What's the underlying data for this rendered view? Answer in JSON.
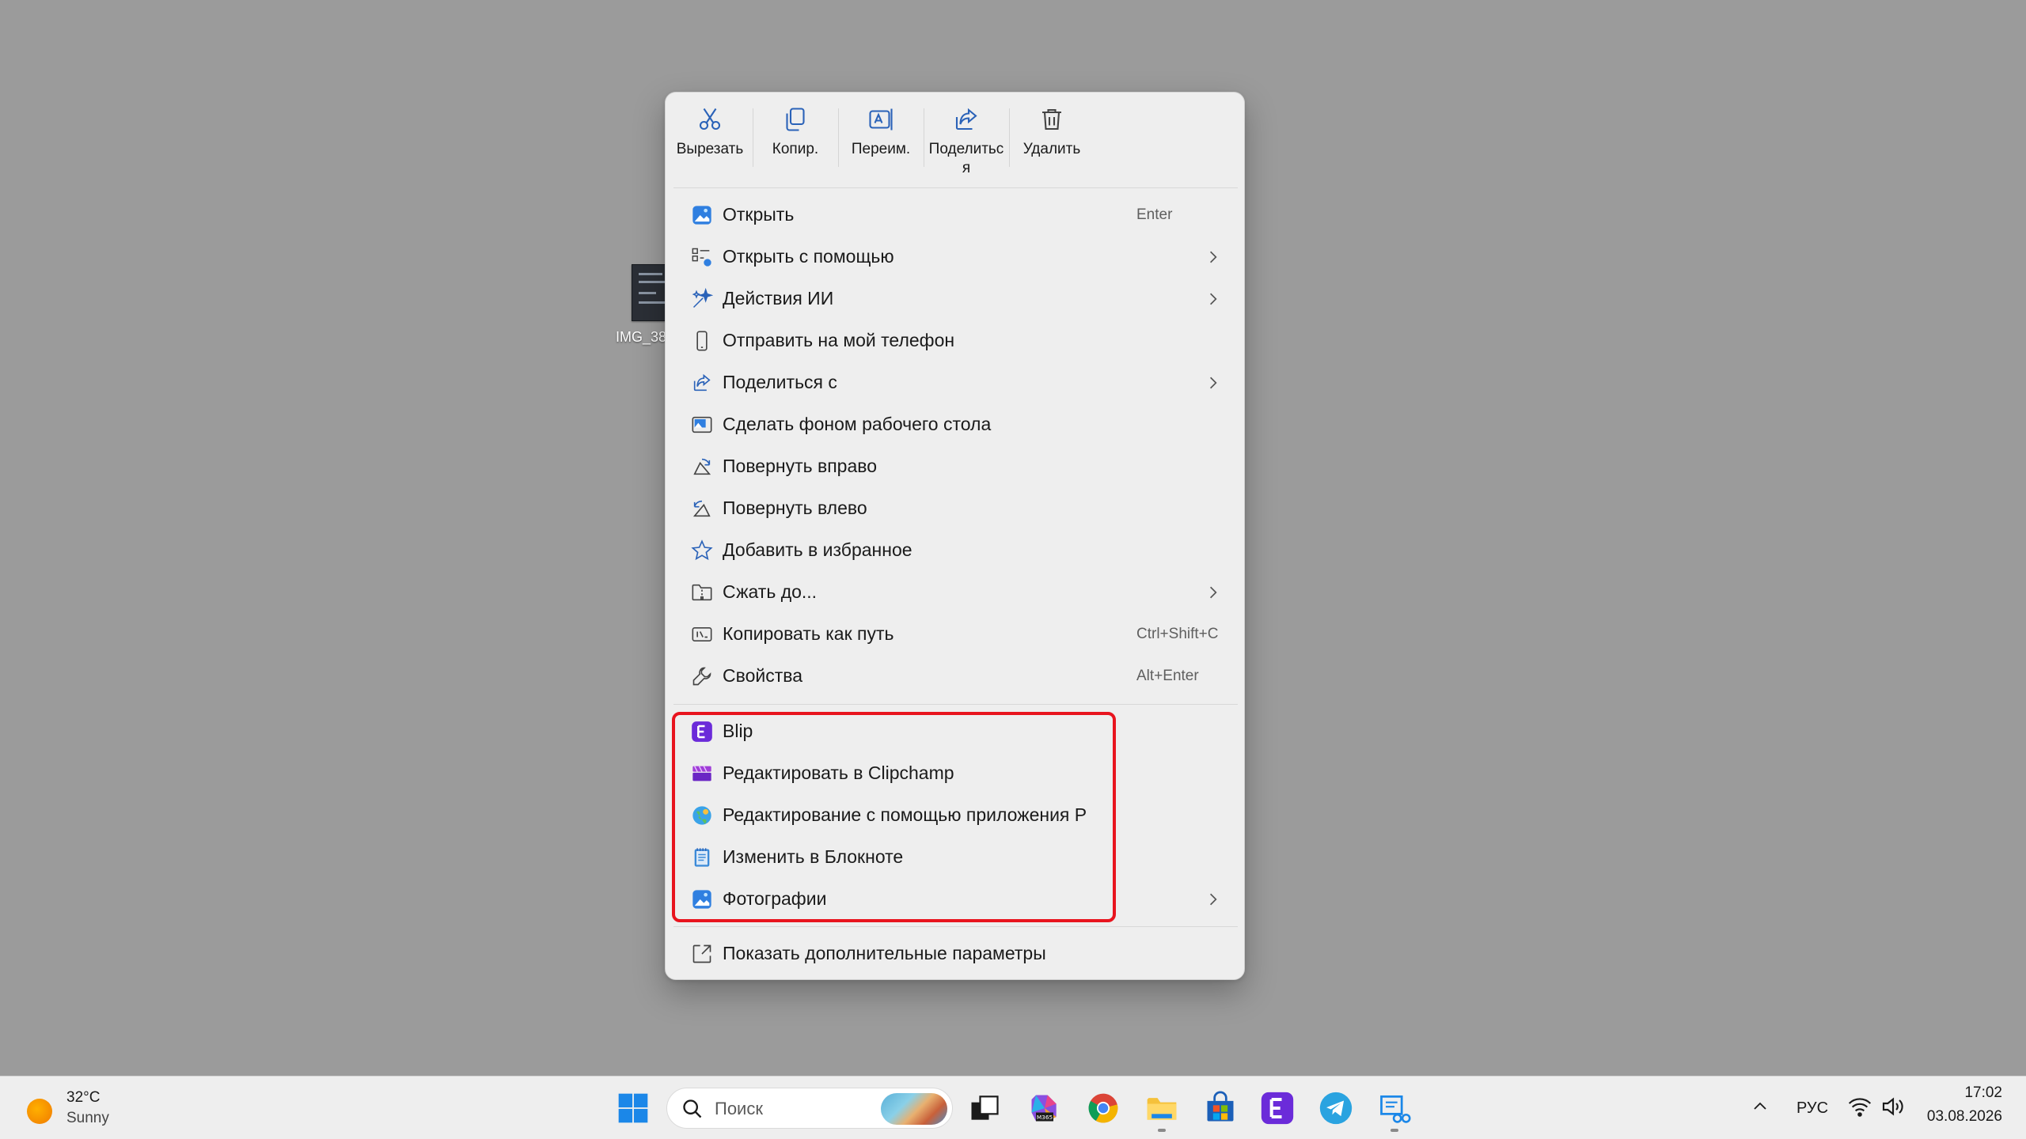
{
  "desktop": {
    "file_label": "IMG_38"
  },
  "quick_actions": [
    {
      "label": "Вырезать",
      "icon": "scissors-icon"
    },
    {
      "label": "Копир.",
      "icon": "copy-icon"
    },
    {
      "label": "Переим.",
      "icon": "rename-icon"
    },
    {
      "label": "Поделиться",
      "icon": "share-icon"
    },
    {
      "label": "Удалить",
      "icon": "trash-icon"
    }
  ],
  "menu_items": [
    {
      "label": "Открыть",
      "shortcut": "Enter",
      "icon": "photos-app-icon"
    },
    {
      "label": "Открыть с помощью",
      "submenu": true,
      "icon": "open-with-icon"
    },
    {
      "label": "Действия ИИ",
      "submenu": true,
      "icon": "ai-sparkle-icon"
    },
    {
      "label": "Отправить на мой телефон",
      "icon": "phone-icon"
    },
    {
      "label": "Поделиться с",
      "submenu": true,
      "icon": "share-icon"
    },
    {
      "label": "Сделать фоном рабочего стола",
      "icon": "wallpaper-icon"
    },
    {
      "label": "Повернуть вправо",
      "icon": "rotate-right-icon"
    },
    {
      "label": "Повернуть влево",
      "icon": "rotate-left-icon"
    },
    {
      "label": "Добавить в избранное",
      "icon": "star-icon"
    },
    {
      "label": "Сжать до...",
      "submenu": true,
      "icon": "zip-folder-icon"
    },
    {
      "label": "Копировать как путь",
      "shortcut": "Ctrl+Shift+C",
      "icon": "copy-path-icon"
    },
    {
      "label": "Свойства",
      "shortcut": "Alt+Enter",
      "icon": "wrench-icon"
    }
  ],
  "app_items": [
    {
      "label": "Blip",
      "icon": "blip-app-icon"
    },
    {
      "label": "Редактировать в Clipchamp",
      "icon": "clipchamp-icon"
    },
    {
      "label": "Редактирование с помощью приложения Р",
      "icon": "paint-globe-icon"
    },
    {
      "label": "Изменить в Блокноте",
      "icon": "notepad-icon"
    },
    {
      "label": "Фотографии",
      "submenu": true,
      "icon": "photos-app-icon"
    }
  ],
  "more_options": {
    "label": "Показать дополнительные параметры",
    "icon": "expand-icon"
  },
  "colors": {
    "highlight": "#e8141e",
    "accent": "#0067c0",
    "blip": "#6b2bd9"
  },
  "taskbar": {
    "weather": {
      "temp": "32°C",
      "condition": "Sunny"
    },
    "search_placeholder": "Поиск",
    "apps": [
      "windows-start-icon",
      "task-view-icon",
      "m365-copilot-icon",
      "chrome-icon",
      "file-explorer-icon",
      "ms-store-icon",
      "blip-app-icon",
      "telegram-icon",
      "snipping-tool-icon"
    ],
    "language": "РУС",
    "time": "17:02",
    "date": "03.08.2026"
  }
}
